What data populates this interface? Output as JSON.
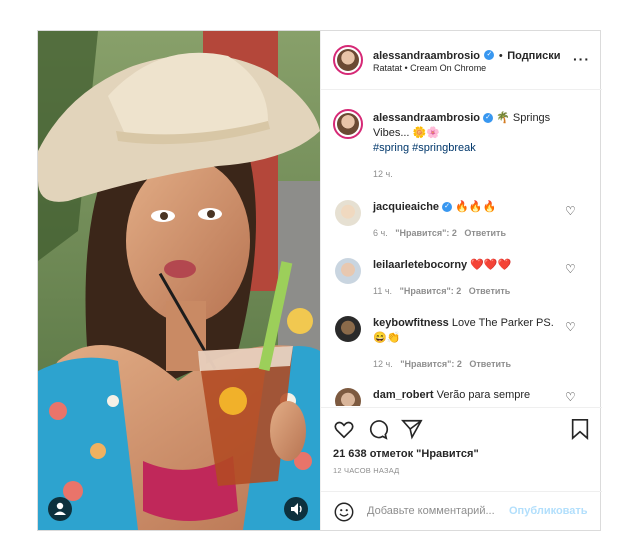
{
  "header": {
    "username": "alessandraambrosio",
    "dot": "•",
    "follow_label": "Подписки",
    "audio": "Ratatat • Cream On Chrome",
    "more_icon": "more-horizontal-icon"
  },
  "caption": {
    "username": "alessandraambrosio",
    "text": "🌴 Springs Vibes... 🌼🌸",
    "hashtags": "#spring #springbreak",
    "time": "12 ч."
  },
  "comments": [
    {
      "username": "jacquieaiche",
      "verified": true,
      "text": "🔥🔥🔥",
      "time": "6 ч.",
      "likes": "\"Нравится\": 2",
      "reply": "Ответить"
    },
    {
      "username": "leilaarletebocorny",
      "verified": false,
      "text": "❤️❤️❤️",
      "time": "11 ч.",
      "likes": "\"Нравится\": 2",
      "reply": "Ответить"
    },
    {
      "username": "keybowfitness",
      "verified": false,
      "text": "Love The Parker PS. 😄👏",
      "time": "12 ч.",
      "likes": "\"Нравится\": 2",
      "reply": "Ответить"
    },
    {
      "username": "dam_robert",
      "verified": false,
      "text": "Verão para sempre",
      "time": "",
      "likes": "",
      "reply": ""
    }
  ],
  "actions": {
    "likes": "21 638 отметок \"Нравится\"",
    "time_ago": "12 ЧАСОВ НАЗАД"
  },
  "add_comment": {
    "placeholder": "Добавьте комментарий...",
    "publish": "Опубликовать"
  },
  "colors": {
    "verified": "#3897f0",
    "link": "#00376b",
    "publish_disabled": "#b2dffc"
  }
}
